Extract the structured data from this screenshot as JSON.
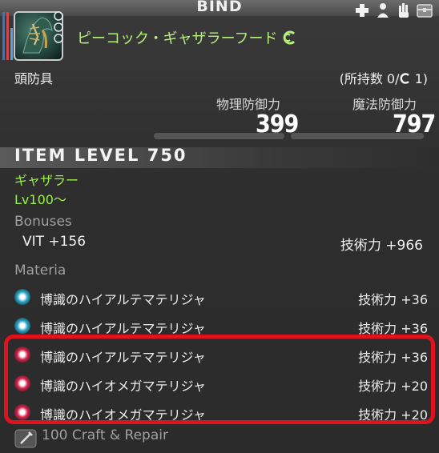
{
  "header": {
    "title": "BIND"
  },
  "top_icons": [
    "cross-icon",
    "person-icon",
    "hand-icon",
    "trunk-icon"
  ],
  "item": {
    "name": "ピーコック・ギャザラーフード",
    "category": "頭防具",
    "owned": "(所持数 0/",
    "owned_suffix": " 1)",
    "physical_label": "物理防御力",
    "physical_value": "399",
    "magic_label": "魔法防御力",
    "magic_value": "797"
  },
  "item_level": "ITEM LEVEL 750",
  "class": "ギャザラー",
  "level": "Lv100～",
  "bonuses": {
    "heading": "Bonuses",
    "left": "VIT +156",
    "right": "技術力 +966"
  },
  "materia": {
    "heading": "Materia",
    "rows": [
      {
        "name": "博識のハイアルテマテリジャ",
        "value": "技術力 +36",
        "color": "#2aa7c9"
      },
      {
        "name": "博識のハイアルテマテリジャ",
        "value": "技術力 +36",
        "color": "#2aa7c9"
      },
      {
        "name": "博識のハイアルテマテリジャ",
        "value": "技術力 +36",
        "color": "#d8264e"
      },
      {
        "name": "博識のハイオメガマテリジャ",
        "value": "技術力 +20",
        "color": "#d8264e"
      },
      {
        "name": "博識のハイオメガマテリジャ",
        "value": "技術力 +20",
        "color": "#d8264e"
      }
    ]
  },
  "repair": "100 Craft & Repair",
  "colors": {
    "name_green": "#b6f07c",
    "highlight": "#e0121e"
  }
}
